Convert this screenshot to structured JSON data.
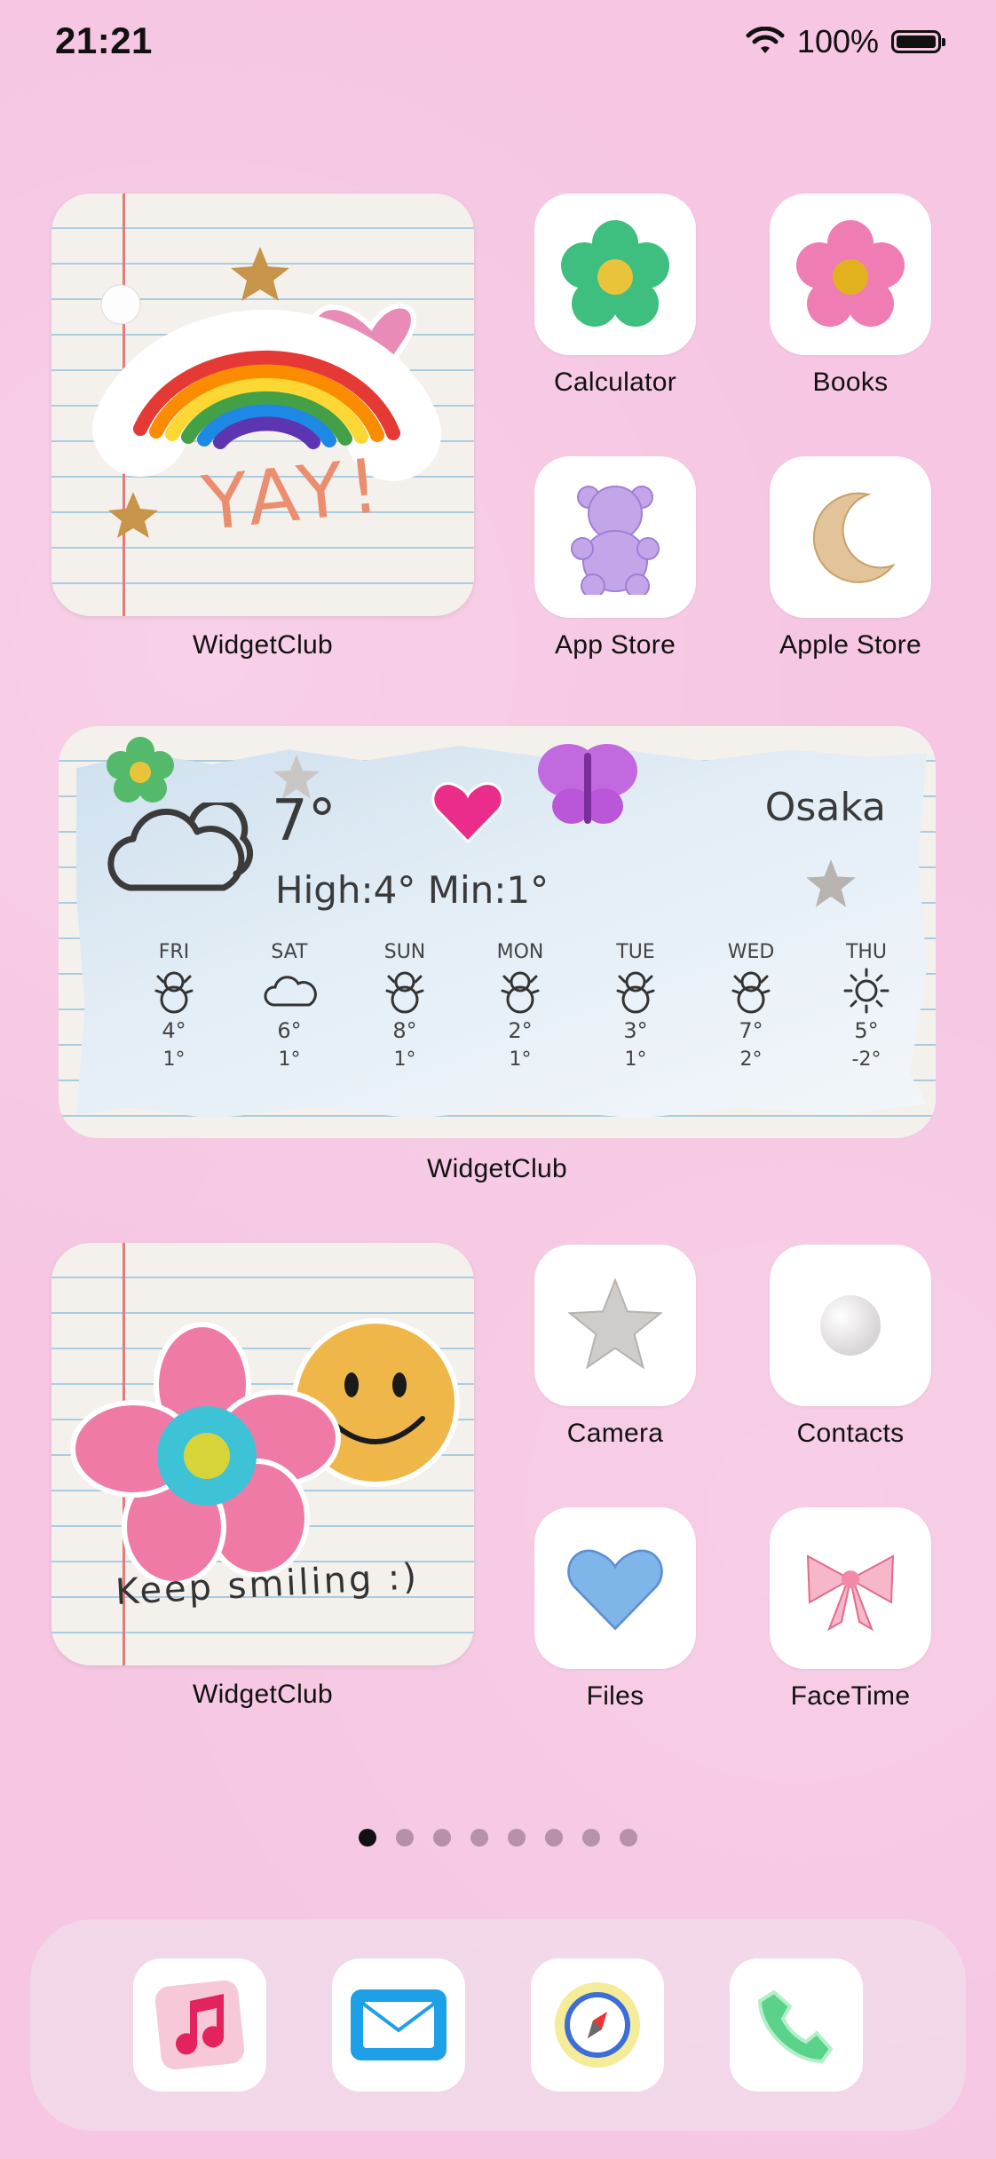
{
  "status_bar": {
    "time": "21:21",
    "battery_percent_label": "100%",
    "battery_level": 1.0
  },
  "widgets": {
    "top_left": {
      "label": "WidgetClub",
      "art_text": "YAY!"
    },
    "weather": {
      "label": "WidgetClub",
      "city": "Osaka",
      "current_temp": "7°",
      "high_low": "High:4° Min:1°",
      "days": [
        {
          "name": "FRI",
          "icon": "snowman-icon",
          "hi": "4°",
          "lo": "1°"
        },
        {
          "name": "SAT",
          "icon": "cloud-icon",
          "hi": "6°",
          "lo": "1°"
        },
        {
          "name": "SUN",
          "icon": "snowman-icon",
          "hi": "8°",
          "lo": "1°"
        },
        {
          "name": "MON",
          "icon": "snowman-icon",
          "hi": "2°",
          "lo": "1°"
        },
        {
          "name": "TUE",
          "icon": "snowman-icon",
          "hi": "3°",
          "lo": "1°"
        },
        {
          "name": "WED",
          "icon": "snowman-icon",
          "hi": "7°",
          "lo": "2°"
        },
        {
          "name": "THU",
          "icon": "sun-icon",
          "hi": "5°",
          "lo": "-2°"
        }
      ]
    },
    "bottom_left": {
      "label": "WidgetClub",
      "art_text": "Keep smiling :)"
    }
  },
  "apps": {
    "calculator": {
      "label": "Calculator",
      "icon": "green-flower-icon"
    },
    "books": {
      "label": "Books",
      "icon": "pink-flower-icon"
    },
    "app_store": {
      "label": "App Store",
      "icon": "purple-bear-icon"
    },
    "apple_store": {
      "label": "Apple Store",
      "icon": "glitter-moon-icon"
    },
    "camera": {
      "label": "Camera",
      "icon": "silver-star-icon"
    },
    "contacts": {
      "label": "Contacts",
      "icon": "pearl-icon"
    },
    "files": {
      "label": "Files",
      "icon": "blue-heart-icon"
    },
    "facetime": {
      "label": "FaceTime",
      "icon": "pink-bow-icon"
    }
  },
  "page_indicator": {
    "count": 8,
    "active_index": 0
  },
  "dock": [
    {
      "name": "music",
      "icon": "music-note-icon"
    },
    {
      "name": "mail",
      "icon": "envelope-icon"
    },
    {
      "name": "safari",
      "icon": "compass-icon"
    },
    {
      "name": "phone",
      "icon": "phone-icon"
    }
  ],
  "colors": {
    "background": "#f6c6e2",
    "tile": "#ffffff",
    "dock": "#f0dceb"
  }
}
